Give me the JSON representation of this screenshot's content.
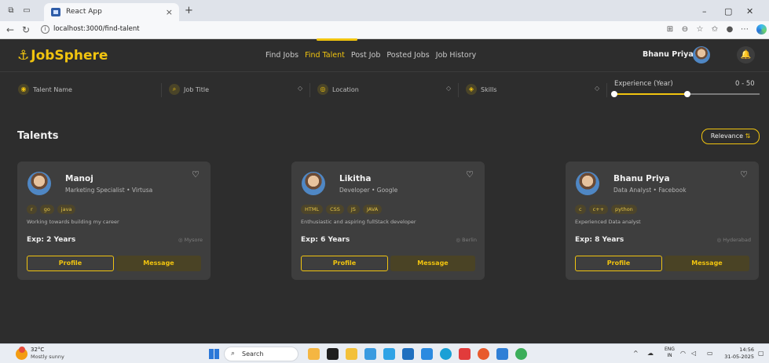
{
  "browser": {
    "tab_title": "React App",
    "url": "localhost:3000/find-talent"
  },
  "app": {
    "logo": "JobSphere",
    "nav": [
      "Find Jobs",
      "Find Talent",
      "Post Job",
      "Posted Jobs",
      "Job History"
    ],
    "active_nav": "Find Talent",
    "user_name": "Bhanu Priya"
  },
  "filters": {
    "talent_name": "Talent Name",
    "job_title": "Job Title",
    "location": "Location",
    "skills": "Skills",
    "experience_label": "Experience (Year)",
    "experience_range": "0 - 50",
    "experience_slider": {
      "min": 0,
      "max": 50,
      "low_fraction": 0.0,
      "high_fraction": 0.5
    }
  },
  "page": {
    "heading": "Talents",
    "sort_label": "Relevance"
  },
  "talents": [
    {
      "name": "Manoj",
      "role": "Marketing Specialist • Virtusa",
      "skills": [
        "r",
        "go",
        "java"
      ],
      "about": "Working towards building my career",
      "experience": "Exp: 2 Years",
      "location": "Mysore",
      "profile_label": "Profile",
      "message_label": "Message"
    },
    {
      "name": "Likitha",
      "role": "Developer • Google",
      "skills": [
        "HTML",
        "CSS",
        "JS",
        "JAVA"
      ],
      "about": "Enthusiastic and aspiring fullStack developer",
      "experience": "Exp: 6 Years",
      "location": "Berlin",
      "profile_label": "Profile",
      "message_label": "Message"
    },
    {
      "name": "Bhanu Priya",
      "role": "Data Analyst • Facebook",
      "skills": [
        "c",
        "c++",
        "python"
      ],
      "about": "Experienced Data analyst",
      "experience": "Exp: 8 Years",
      "location": "Hyderabad",
      "profile_label": "Profile",
      "message_label": "Message"
    }
  ],
  "taskbar": {
    "temperature": "32°C",
    "weather": "Mostly sunny",
    "search_label": "Search",
    "lang_line1": "ENG",
    "lang_line2": "IN",
    "time": "14:56",
    "date": "31-05-2025"
  },
  "colors": {
    "accent": "#f1c40f",
    "background": "#2d2d2d",
    "card": "#3e3e3e"
  }
}
